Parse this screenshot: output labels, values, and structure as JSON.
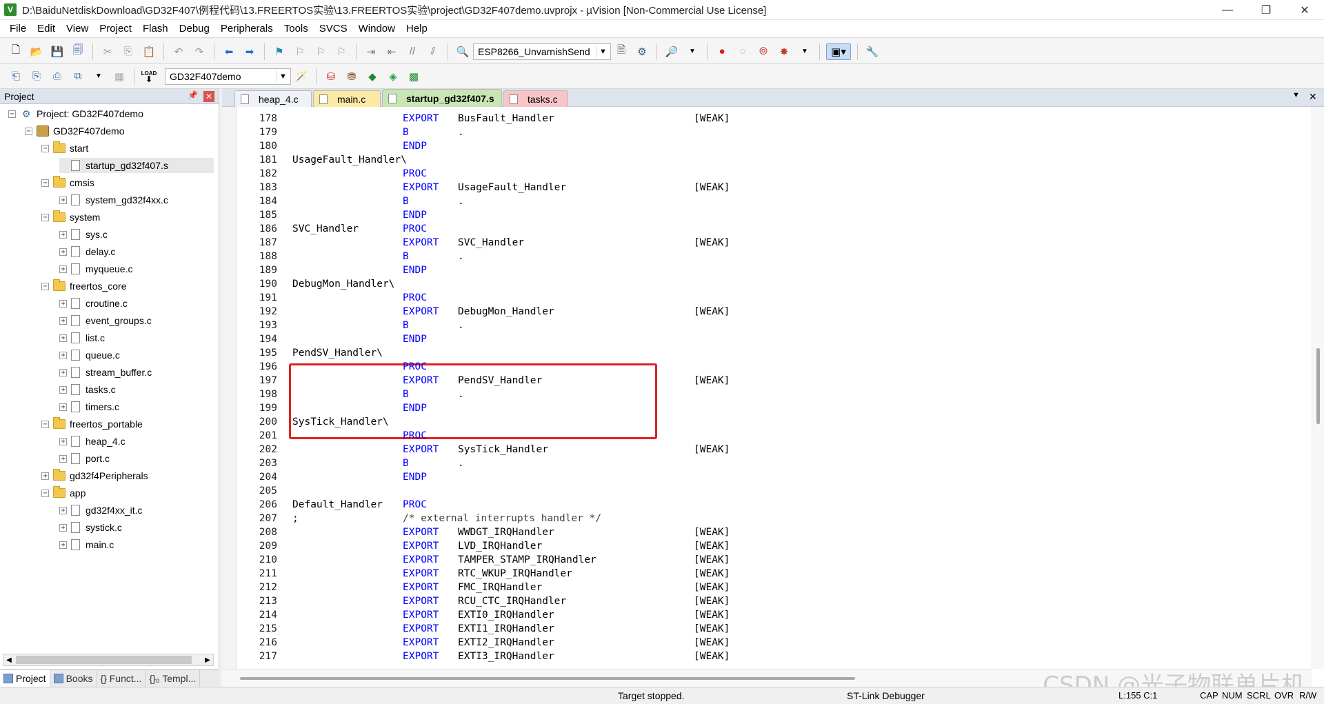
{
  "window": {
    "title": "D:\\BaiduNetdiskDownload\\GD32F407\\例程代码\\13.FREERTOS实验\\13.FREERTOS实验\\project\\GD32F407demo.uvprojx - µVision  [Non-Commercial Use License]",
    "icon_letter": "V",
    "min_glyph": "—",
    "max_glyph": "❐",
    "close_glyph": "✕"
  },
  "menu": [
    "File",
    "Edit",
    "View",
    "Project",
    "Flash",
    "Debug",
    "Peripherals",
    "Tools",
    "SVCS",
    "Window",
    "Help"
  ],
  "toolbar": {
    "target_combo": "ESP8266_UnvarnishSend",
    "project_combo": "GD32F407demo",
    "load_label": "LOAD"
  },
  "project_panel": {
    "title": "Project",
    "pin_glyph": "📌",
    "close_glyph": "✕",
    "tree": [
      {
        "label": "Project: GD32F407demo",
        "kind": "project",
        "toggle": "−",
        "level": 0
      },
      {
        "label": "GD32F407demo",
        "kind": "target",
        "toggle": "−",
        "level": 1
      },
      {
        "label": "start",
        "kind": "folder",
        "toggle": "−",
        "level": 2
      },
      {
        "label": "startup_gd32f407.s",
        "kind": "file",
        "toggle": "",
        "level": 3,
        "selected": true
      },
      {
        "label": "cmsis",
        "kind": "folder",
        "toggle": "−",
        "level": 2
      },
      {
        "label": "system_gd32f4xx.c",
        "kind": "file",
        "toggle": "+",
        "level": 3
      },
      {
        "label": "system",
        "kind": "folder",
        "toggle": "−",
        "level": 2
      },
      {
        "label": "sys.c",
        "kind": "file",
        "toggle": "+",
        "level": 3
      },
      {
        "label": "delay.c",
        "kind": "file",
        "toggle": "+",
        "level": 3
      },
      {
        "label": "myqueue.c",
        "kind": "file",
        "toggle": "+",
        "level": 3
      },
      {
        "label": "freertos_core",
        "kind": "folder",
        "toggle": "−",
        "level": 2
      },
      {
        "label": "croutine.c",
        "kind": "file",
        "toggle": "+",
        "level": 3
      },
      {
        "label": "event_groups.c",
        "kind": "file",
        "toggle": "+",
        "level": 3
      },
      {
        "label": "list.c",
        "kind": "file",
        "toggle": "+",
        "level": 3
      },
      {
        "label": "queue.c",
        "kind": "file",
        "toggle": "+",
        "level": 3
      },
      {
        "label": "stream_buffer.c",
        "kind": "file",
        "toggle": "+",
        "level": 3
      },
      {
        "label": "tasks.c",
        "kind": "file",
        "toggle": "+",
        "level": 3
      },
      {
        "label": "timers.c",
        "kind": "file",
        "toggle": "+",
        "level": 3
      },
      {
        "label": "freertos_portable",
        "kind": "folder",
        "toggle": "−",
        "level": 2
      },
      {
        "label": "heap_4.c",
        "kind": "file",
        "toggle": "+",
        "level": 3
      },
      {
        "label": "port.c",
        "kind": "file",
        "toggle": "+",
        "level": 3
      },
      {
        "label": "gd32f4Peripherals",
        "kind": "folder",
        "toggle": "+",
        "level": 2
      },
      {
        "label": "app",
        "kind": "folder",
        "toggle": "−",
        "level": 2
      },
      {
        "label": "gd32f4xx_it.c",
        "kind": "file",
        "toggle": "+",
        "level": 3
      },
      {
        "label": "systick.c",
        "kind": "file",
        "toggle": "+",
        "level": 3
      },
      {
        "label": "main.c",
        "kind": "file",
        "toggle": "+",
        "level": 3
      }
    ],
    "bottom_tabs": [
      {
        "label": "Project",
        "active": true
      },
      {
        "label": "Books",
        "active": false
      },
      {
        "label": "{} Funct...",
        "active": false
      },
      {
        "label": "{}₀ Templ...",
        "active": false
      }
    ]
  },
  "editor": {
    "tabs": [
      {
        "label": "heap_4.c",
        "bg": "#eef1f6",
        "active": false
      },
      {
        "label": "main.c",
        "bg": "#fbe9a6",
        "active": false
      },
      {
        "label": "startup_gd32f407.s",
        "bg": "#c8e6b4",
        "active": true
      },
      {
        "label": "tasks.c",
        "bg": "#f7c4c8",
        "active": false
      }
    ],
    "dropdown_glyph": "▼",
    "close_glyph": "✕",
    "lines": [
      {
        "n": "178",
        "c1": "",
        "kw": "EXPORT",
        "c3": "BusFault_Handler",
        "c4": "[WEAK]"
      },
      {
        "n": "179",
        "c1": "",
        "kw": "B",
        "c3": ".",
        "c4": ""
      },
      {
        "n": "180",
        "c1": "",
        "kw": "ENDP",
        "c3": "",
        "c4": ""
      },
      {
        "n": "181",
        "c1": "UsageFault_Handler\\",
        "kw": "",
        "c3": "",
        "c4": ""
      },
      {
        "n": "182",
        "c1": "",
        "kw": "PROC",
        "c3": "",
        "c4": ""
      },
      {
        "n": "183",
        "c1": "",
        "kw": "EXPORT",
        "c3": "UsageFault_Handler",
        "c4": "[WEAK]"
      },
      {
        "n": "184",
        "c1": "",
        "kw": "B",
        "c3": ".",
        "c4": ""
      },
      {
        "n": "185",
        "c1": "",
        "kw": "ENDP",
        "c3": "",
        "c4": ""
      },
      {
        "n": "186",
        "c1": "SVC_Handler",
        "kw": "PROC",
        "c3": "",
        "c4": ""
      },
      {
        "n": "187",
        "c1": "",
        "kw": "EXPORT",
        "c3": "SVC_Handler",
        "c4": "[WEAK]"
      },
      {
        "n": "188",
        "c1": "",
        "kw": "B",
        "c3": ".",
        "c4": ""
      },
      {
        "n": "189",
        "c1": "",
        "kw": "ENDP",
        "c3": "",
        "c4": ""
      },
      {
        "n": "190",
        "c1": "DebugMon_Handler\\",
        "kw": "",
        "c3": "",
        "c4": ""
      },
      {
        "n": "191",
        "c1": "",
        "kw": "PROC",
        "c3": "",
        "c4": ""
      },
      {
        "n": "192",
        "c1": "",
        "kw": "EXPORT",
        "c3": "DebugMon_Handler",
        "c4": "[WEAK]"
      },
      {
        "n": "193",
        "c1": "",
        "kw": "B",
        "c3": ".",
        "c4": ""
      },
      {
        "n": "194",
        "c1": "",
        "kw": "ENDP",
        "c3": "",
        "c4": ""
      },
      {
        "n": "195",
        "c1": "PendSV_Handler\\",
        "kw": "",
        "c3": "",
        "c4": ""
      },
      {
        "n": "196",
        "c1": "",
        "kw": "PROC",
        "c3": "",
        "c4": ""
      },
      {
        "n": "197",
        "c1": "",
        "kw": "EXPORT",
        "c3": "PendSV_Handler",
        "c4": "[WEAK]"
      },
      {
        "n": "198",
        "c1": "",
        "kw": "B",
        "c3": ".",
        "c4": ""
      },
      {
        "n": "199",
        "c1": "",
        "kw": "ENDP",
        "c3": "",
        "c4": ""
      },
      {
        "n": "200",
        "c1": "SysTick_Handler\\",
        "kw": "",
        "c3": "",
        "c4": ""
      },
      {
        "n": "201",
        "c1": "",
        "kw": "PROC",
        "c3": "",
        "c4": ""
      },
      {
        "n": "202",
        "c1": "",
        "kw": "EXPORT",
        "c3": "SysTick_Handler",
        "c4": "[WEAK]"
      },
      {
        "n": "203",
        "c1": "",
        "kw": "B",
        "c3": ".",
        "c4": ""
      },
      {
        "n": "204",
        "c1": "",
        "kw": "ENDP",
        "c3": "",
        "c4": ""
      },
      {
        "n": "205",
        "c1": "",
        "kw": "",
        "c3": "",
        "c4": ""
      },
      {
        "n": "206",
        "c1": "Default_Handler",
        "kw": "PROC",
        "c3": "",
        "c4": ""
      },
      {
        "n": "207",
        "c1": ";",
        "kw": "",
        "cmt": "/* external interrupts handler */",
        "c3": "",
        "c4": ""
      },
      {
        "n": "208",
        "c1": "",
        "kw": "EXPORT",
        "c3": "WWDGT_IRQHandler",
        "c4": "[WEAK]"
      },
      {
        "n": "209",
        "c1": "",
        "kw": "EXPORT",
        "c3": "LVD_IRQHandler",
        "c4": "[WEAK]"
      },
      {
        "n": "210",
        "c1": "",
        "kw": "EXPORT",
        "c3": "TAMPER_STAMP_IRQHandler",
        "c4": "[WEAK]"
      },
      {
        "n": "211",
        "c1": "",
        "kw": "EXPORT",
        "c3": "RTC_WKUP_IRQHandler",
        "c4": "[WEAK]"
      },
      {
        "n": "212",
        "c1": "",
        "kw": "EXPORT",
        "c3": "FMC_IRQHandler",
        "c4": "[WEAK]"
      },
      {
        "n": "213",
        "c1": "",
        "kw": "EXPORT",
        "c3": "RCU_CTC_IRQHandler",
        "c4": "[WEAK]"
      },
      {
        "n": "214",
        "c1": "",
        "kw": "EXPORT",
        "c3": "EXTI0_IRQHandler",
        "c4": "[WEAK]"
      },
      {
        "n": "215",
        "c1": "",
        "kw": "EXPORT",
        "c3": "EXTI1_IRQHandler",
        "c4": "[WEAK]"
      },
      {
        "n": "216",
        "c1": "",
        "kw": "EXPORT",
        "c3": "EXTI2_IRQHandler",
        "c4": "[WEAK]"
      },
      {
        "n": "217",
        "c1": "",
        "kw": "EXPORT",
        "c3": "EXTI3_IRQHandler",
        "c4": "[WEAK]"
      }
    ]
  },
  "statusbar": {
    "state": "Target stopped.",
    "debugger": "ST-Link Debugger",
    "position": "L:155 C:1",
    "cap": "CAP",
    "num": "NUM",
    "scrl": "SCRL",
    "ovr": "OVR",
    "rw": "R/W"
  },
  "watermark": "CSDN @光子物联单片机",
  "colors": {
    "keyword": "#0000ff",
    "highlight": "#e02020"
  }
}
